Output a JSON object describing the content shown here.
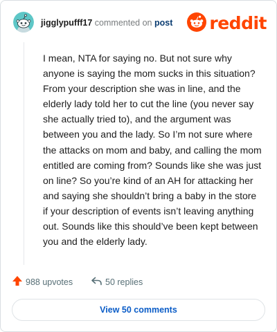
{
  "header": {
    "author": "jigglypufff17",
    "action_text": "commented on",
    "post_link": "post",
    "logo_text": "reddit"
  },
  "comment": {
    "text": "I mean, NTA for saying no. But not sure why anyone is saying the mom sucks in this situation? From your description she was in line, and the elderly lady told her to cut the line (you never say she actually tried to), and the argument was between you and the lady. So I’m not sure where the attacks on mom and baby, and calling the mom entitled are coming from? Sounds like she was just on line? So you’re kind of an AH for attacking her and saying she shouldn’t bring a baby in the store if your description of events isn’t leaving anything out. Sounds like this should’ve been kept between you and the elderly lady."
  },
  "actions": {
    "upvotes_label": "988 upvotes",
    "replies_label": "50 replies"
  },
  "footer": {
    "view_comments_label": "View 50 comments"
  },
  "colors": {
    "brand": "#ff4500",
    "link": "#0a3c71",
    "button_text": "#0a5cc7",
    "muted": "#576f76"
  },
  "icons": [
    "snoo-avatar-icon",
    "reddit-logo-icon",
    "upvote-arrow-icon",
    "reply-arrow-icon"
  ]
}
